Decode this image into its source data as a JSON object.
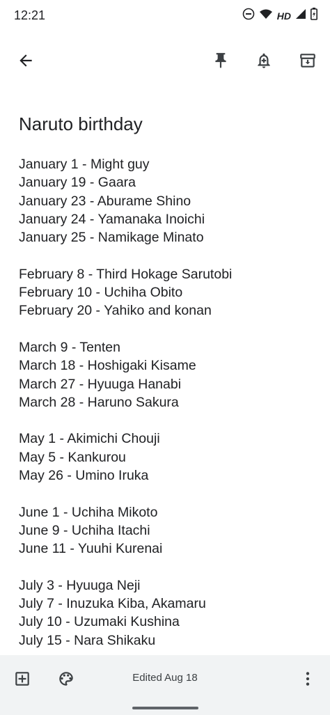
{
  "status_bar": {
    "time": "12:21",
    "network_label": "HD"
  },
  "toolbar": {
    "icons": [
      "arrow-back-icon",
      "pin-icon",
      "add-alert-icon",
      "archive-icon"
    ]
  },
  "note": {
    "title": "Naruto birthday",
    "lines": [
      "January 1 - Might guy",
      "January 19 - Gaara",
      "January 23 - Aburame Shino",
      "January 24 - Yamanaka Inoichi",
      "January 25 - Namikage Minato",
      "",
      "February 8 - Third Hokage Sarutobi",
      "February 10 - Uchiha Obito",
      "February 20 - Yahiko and konan",
      "",
      "March 9 - Tenten",
      "March 18 - Hoshigaki Kisame",
      "March 27 - Hyuuga Hanabi",
      "March 28 - Haruno Sakura",
      "",
      "May 1 - Akimichi Chouji",
      "May 5 - Kankurou",
      "May 26 - Umino Iruka",
      "",
      "June 1 - Uchiha Mikoto",
      "June 9 - Uchiha Itachi",
      "June 11 - Yuuhi Kurenai",
      "",
      "July 3 - Hyuuga Neji",
      "July 7 - Inuzuka Kiba, Akamaru",
      "July 10 - Uzumaki Kushina",
      "July 15 - Nara Shikaku"
    ]
  },
  "bottom_bar": {
    "edited_label": "Edited Aug 18"
  },
  "colors": {
    "background": "#ffffff",
    "text": "#202124",
    "icon": "#3c4043",
    "bottom_bar": "#f1f3f4"
  }
}
